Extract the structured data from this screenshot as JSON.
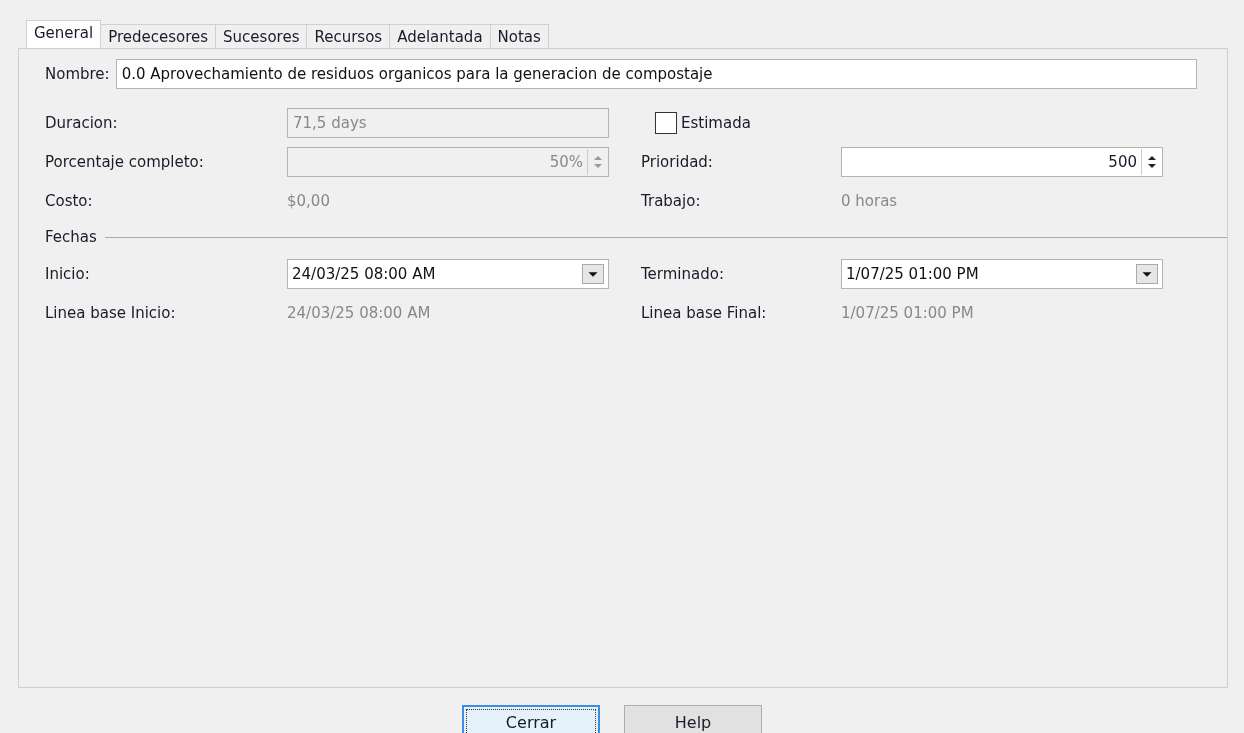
{
  "tabs": [
    {
      "label": "General",
      "selected": true
    },
    {
      "label": "Predecesores",
      "selected": false
    },
    {
      "label": "Sucesores",
      "selected": false
    },
    {
      "label": "Recursos",
      "selected": false
    },
    {
      "label": "Adelantada",
      "selected": false
    },
    {
      "label": "Notas",
      "selected": false
    }
  ],
  "name": {
    "label": "Nombre:",
    "value": "0.0 Aprovechamiento de residuos organicos para la generacion de compostaje"
  },
  "duration": {
    "label": "Duracion:",
    "value": "71,5 days",
    "disabled": true
  },
  "estimated": {
    "label": "Estimada",
    "checked": false
  },
  "percent": {
    "label": "Porcentaje completo:",
    "value": "50%",
    "disabled": true
  },
  "priority": {
    "label": "Prioridad:",
    "value": "500",
    "disabled": false
  },
  "cost": {
    "label": "Costo:",
    "value": "$0,00"
  },
  "work": {
    "label": "Trabajo:",
    "value": "0 horas"
  },
  "dates_section": "Fechas",
  "start": {
    "label": "Inicio:",
    "value": "24/03/25 08:00 AM"
  },
  "finish": {
    "label": "Terminado:",
    "value": "1/07/25 01:00 PM"
  },
  "baseline_start": {
    "label": "Linea base Inicio:",
    "value": "24/03/25 08:00 AM"
  },
  "baseline_finish": {
    "label": "Linea base Final:",
    "value": "1/07/25 01:00 PM"
  },
  "buttons": [
    {
      "label": "Cerrar",
      "focused": true
    },
    {
      "label": "Help",
      "focused": false
    }
  ]
}
